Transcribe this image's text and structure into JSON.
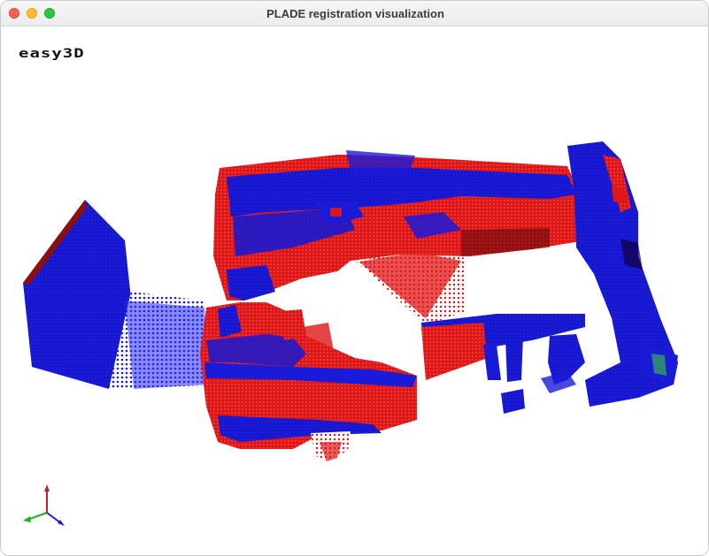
{
  "window": {
    "title": "PLADE registration visualization"
  },
  "viewer": {
    "logo_text": "easy3D",
    "point_cloud_colors": {
      "source": "#e01515",
      "target": "#1a1ad9",
      "shadow": "#3a0a0a"
    },
    "axes_colors": {
      "x": "#2020c0",
      "y": "#20b020",
      "z": "#c02020"
    },
    "icons": [
      "axes-gizmo-icon"
    ]
  }
}
